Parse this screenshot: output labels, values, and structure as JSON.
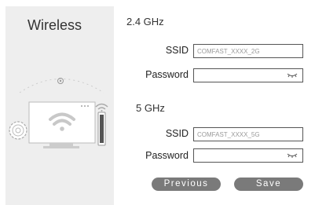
{
  "sidebar": {
    "title": "Wireless"
  },
  "band_24": {
    "title": "2.4 GHz",
    "ssid_label": "SSID",
    "ssid_value": "COMFAST_XXXX_2G",
    "password_label": "Password",
    "password_value": ""
  },
  "band_5": {
    "title": "5 GHz",
    "ssid_label": "SSID",
    "ssid_value": "COMFAST_XXXX_5G",
    "password_label": "Password",
    "password_value": ""
  },
  "buttons": {
    "previous_label": "Previous",
    "save_label": "Save"
  },
  "icons": {
    "password_toggle": "eye-closed-icon",
    "illustration": "router-monitor-wifi-illustration"
  },
  "colors": {
    "button_bg": "#7a7a7a",
    "sidebar_bg": "#eeeeee",
    "border": "#555555"
  }
}
